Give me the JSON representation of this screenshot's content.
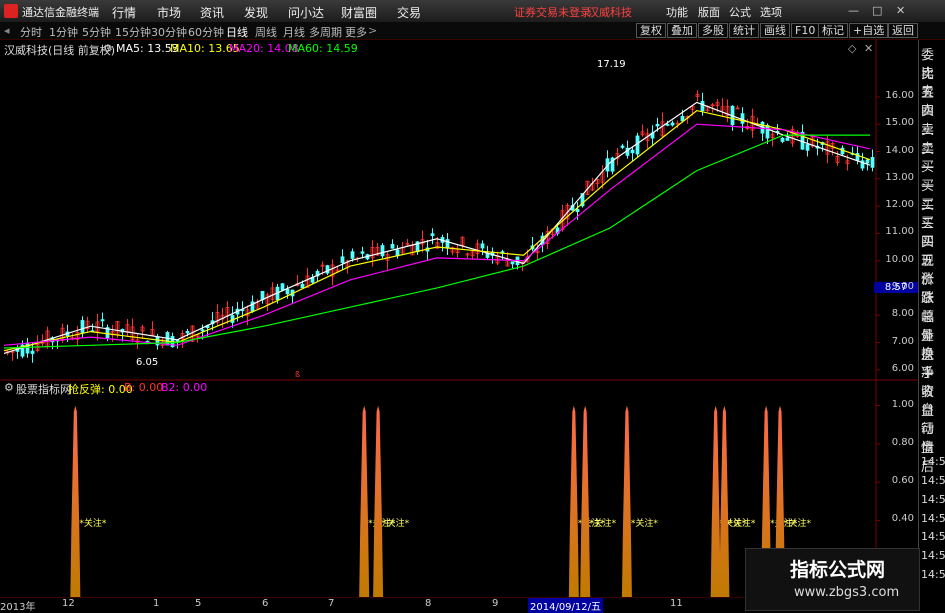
{
  "app": {
    "title": "通达信金融终端"
  },
  "menu": [
    "行情",
    "市场",
    "资讯",
    "发现",
    "问小达",
    "财富圈",
    "交易"
  ],
  "status": {
    "trade_notice": "证券交易未登录",
    "stock_tag": "汉威科技"
  },
  "right_menu": [
    "功能",
    "版面",
    "公式",
    "选项"
  ],
  "window_btns": [
    "—",
    "□",
    "✕"
  ],
  "periods": [
    "分时",
    "1分钟",
    "5分钟",
    "15分钟",
    "30分钟",
    "60分钟",
    "日线",
    "周线",
    "月线",
    "多周期",
    "更多"
  ],
  "active_period": "日线",
  "tools": [
    "复权",
    "叠加",
    "多股",
    "统计",
    "画线",
    "F10",
    "标记",
    "+自选",
    "返回"
  ],
  "chart_header": {
    "stock": "汉威科技(日线 前复权)",
    "ma5": "MA5: 13.53",
    "ma10": "MA10: 13.65",
    "ma20": "MA20: 14.08",
    "ma60": "MA60: 14.59"
  },
  "annotations": {
    "high": "17.19",
    "low": "6.05",
    "current_price": "8.57",
    "marker": "ß"
  },
  "indicator_header": {
    "name": "股票指标网",
    "var1": "抢反弹: 0.00",
    "var2": "B: 0.00",
    "var3": "B2: 0.00"
  },
  "indicator_label": "关注",
  "right_side": [
    "委比",
    "卖五",
    "卖四",
    "卖三",
    "卖二",
    "卖一",
    "买一",
    "买二",
    "买三",
    "买四",
    "买五",
    "现价",
    "涨跌",
    "涨幅",
    "总量",
    "外盘",
    "换手",
    "净资",
    "收益",
    "自动",
    "行情",
    "盘后",
    "14:50",
    "14:50",
    "14:50",
    "14:50",
    "14:50",
    "14:50",
    "14:50"
  ],
  "x_axis": {
    "labels": [
      "2013年",
      "12",
      "1",
      "5",
      "6",
      "7",
      "8",
      "9",
      "2014/09/12/五",
      "11",
      "12"
    ]
  },
  "watermark": {
    "main": "指标公式网",
    "url": "www.zbgs3.com"
  },
  "colors": {
    "up": "#ff3232",
    "down": "#54ffff",
    "ma5": "#ffffff",
    "ma10": "#ffff00",
    "ma20": "#ff00ff",
    "ma60": "#00ff00"
  },
  "chart_data": {
    "type": "line",
    "title": "",
    "x": [
      "2013年",
      "12",
      "1",
      "5",
      "6",
      "7",
      "8",
      "9",
      "2014/09/12/五",
      "11",
      "12"
    ],
    "series": [
      {
        "name": "MA5",
        "values": [
          6.6,
          7.6,
          7.1,
          8.6,
          10.0,
          10.8,
          9.9,
          13.6,
          15.8,
          14.6,
          13.5
        ]
      },
      {
        "name": "MA10",
        "values": [
          6.7,
          7.4,
          7.0,
          8.3,
          9.8,
          10.5,
          10.2,
          13.0,
          15.5,
          14.8,
          13.7
        ]
      },
      {
        "name": "MA20",
        "values": [
          6.9,
          7.2,
          6.9,
          8.0,
          9.3,
          10.1,
          10.0,
          12.6,
          15.0,
          14.8,
          14.1
        ]
      },
      {
        "name": "MA60",
        "values": [
          6.8,
          6.9,
          7.0,
          7.6,
          8.3,
          9.0,
          9.8,
          11.2,
          13.3,
          14.6,
          14.6
        ]
      }
    ],
    "price_axis": [
      "16.00",
      "15.00",
      "14.00",
      "13.00",
      "12.00",
      "11.00",
      "10.00",
      "9.00",
      "8.00",
      "7.00",
      "6.00"
    ],
    "ylim": [
      5.7,
      17.5
    ],
    "indicator": {
      "axis": [
        "1.00",
        "0.80",
        "0.60",
        "0.40"
      ],
      "ylim": [
        0,
        1.05
      ],
      "spikes": [
        0.082,
        0.414,
        0.43,
        0.655,
        0.668,
        0.716,
        0.818,
        0.828,
        0.876,
        0.892
      ]
    }
  }
}
